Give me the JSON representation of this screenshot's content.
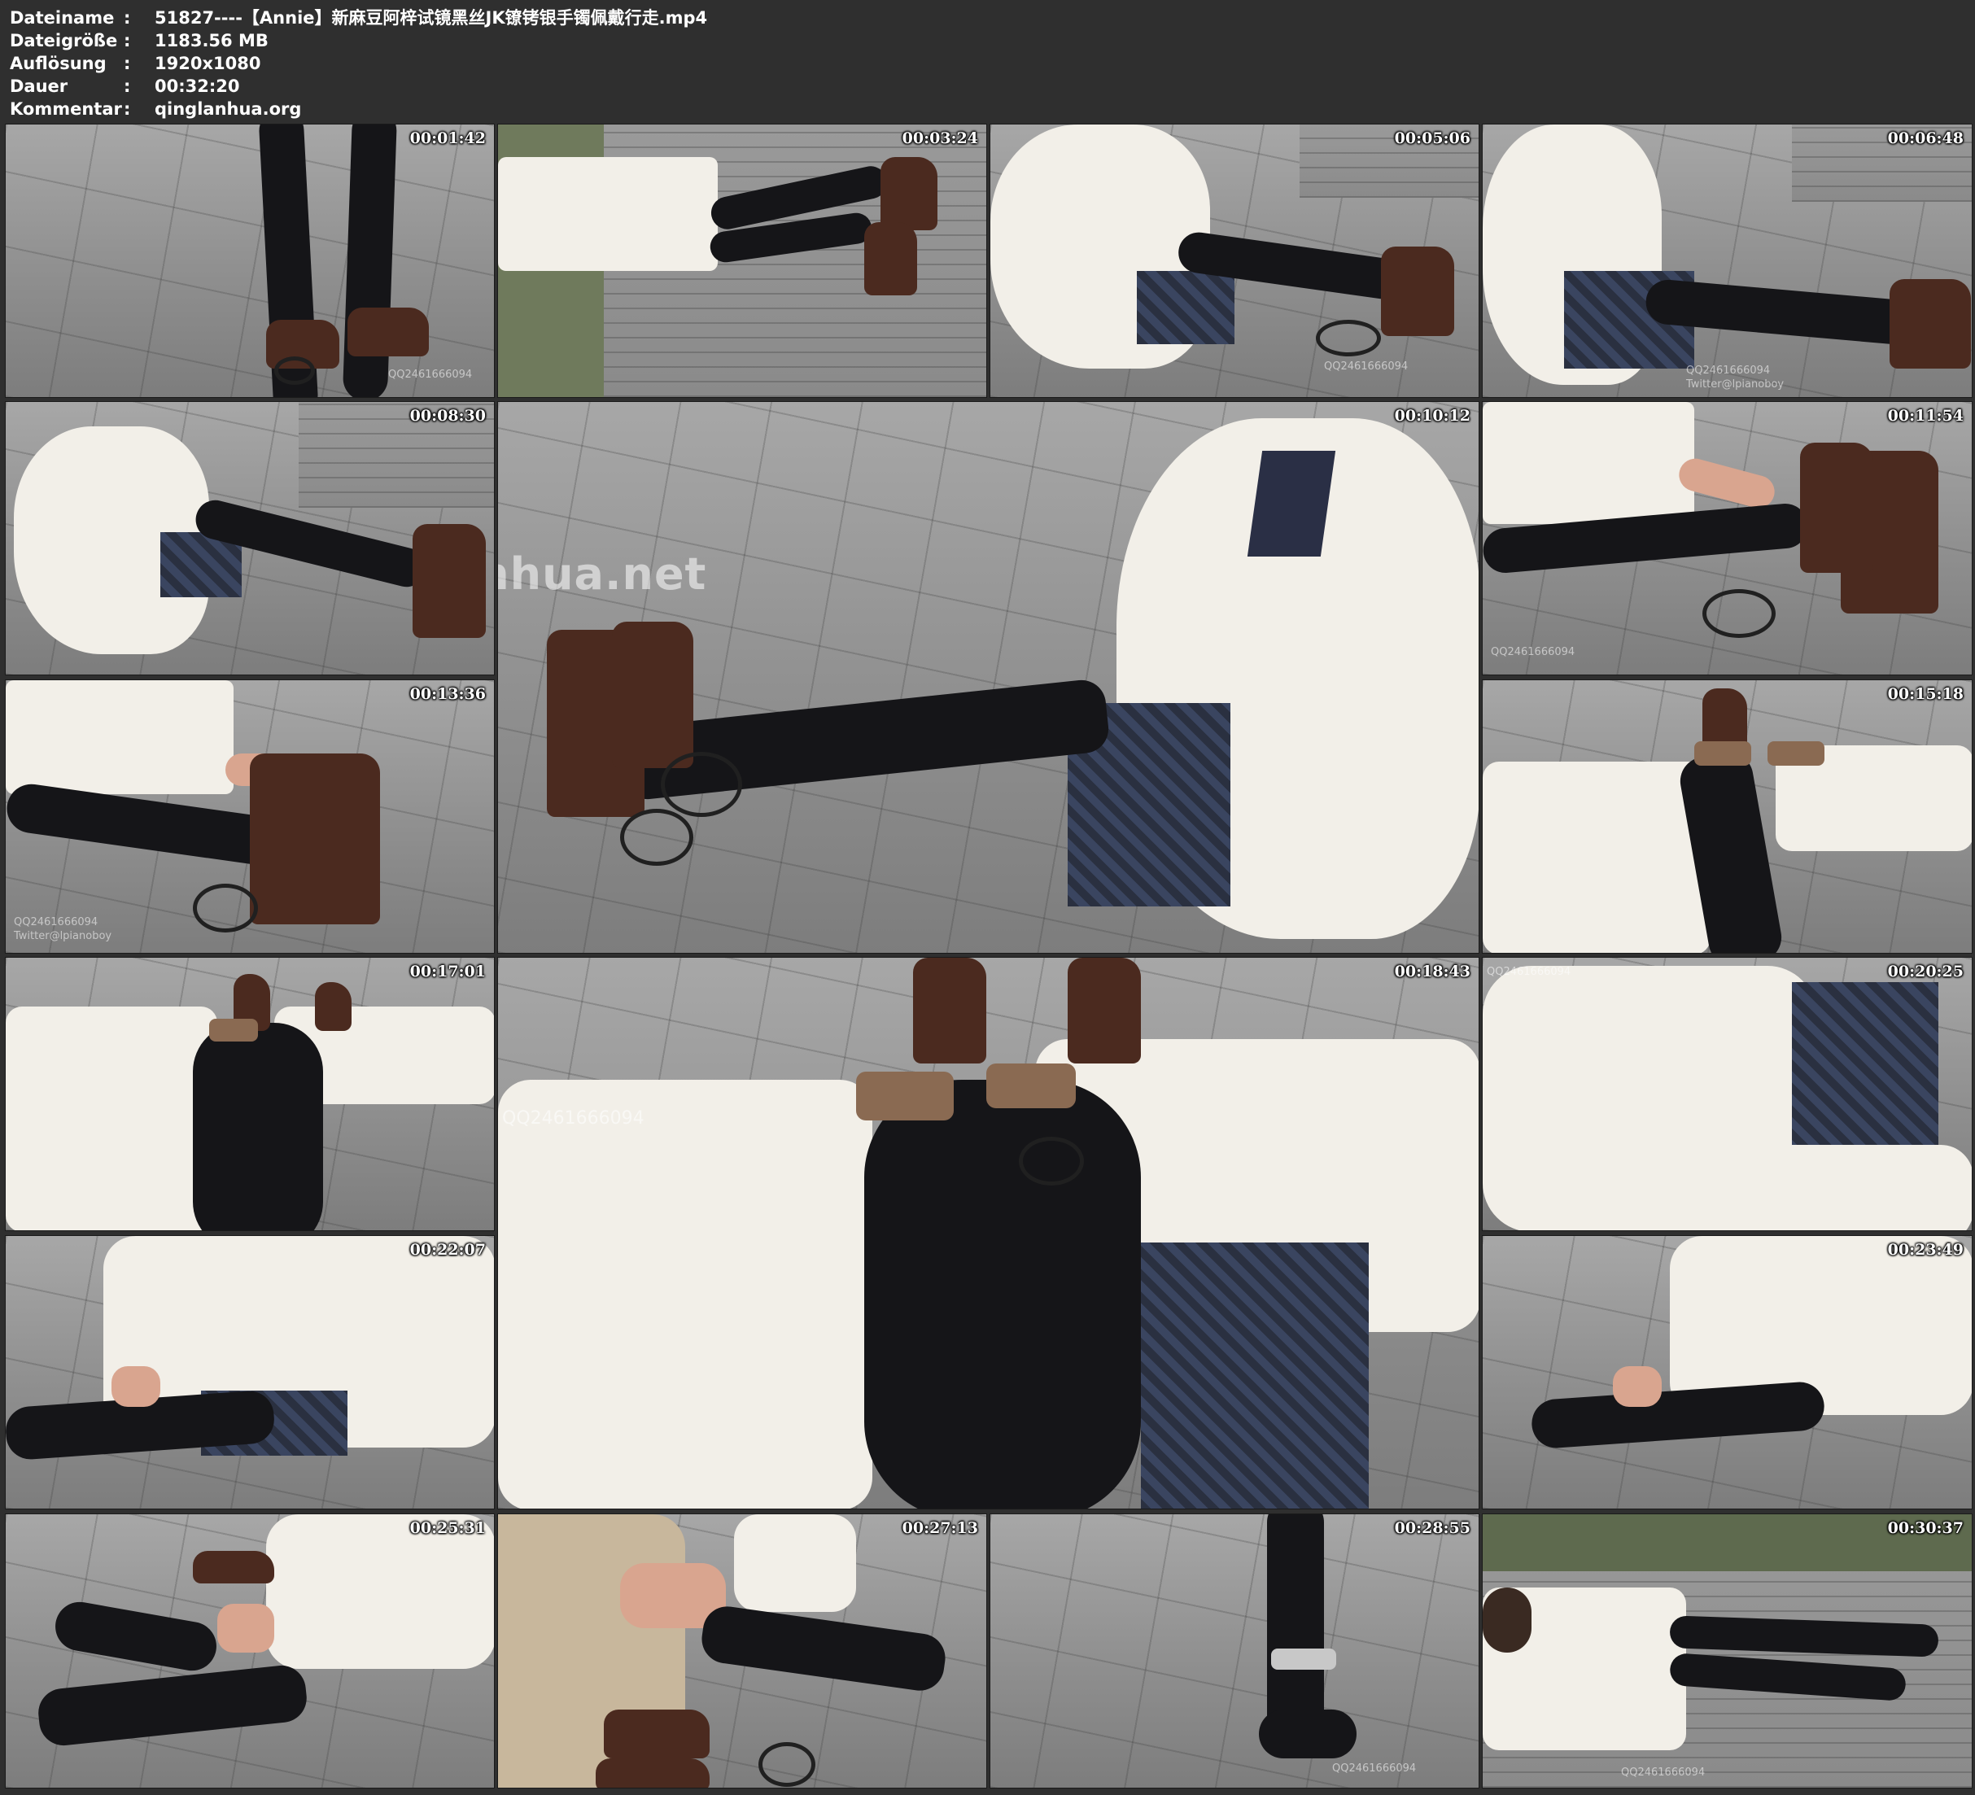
{
  "metadata": {
    "rows": [
      {
        "key": "Dateiname",
        "value": "51827----【Annie】新麻豆阿梓试镜黑丝JK镣铐银手镯佩戴行走.mp4"
      },
      {
        "key": "Dateigröße",
        "value": "1183.56 MB"
      },
      {
        "key": "Auflösung",
        "value": "1920x1080"
      },
      {
        "key": "Dauer",
        "value": "00:32:20"
      },
      {
        "key": "Kommentar",
        "value": "qinglanhua.org"
      }
    ],
    "separator": ":"
  },
  "thumbnails": [
    {
      "timestamp": "00:01:42",
      "scene": "legs-standing-pavement"
    },
    {
      "timestamp": "00:03:24",
      "scene": "legs-rotated-wall"
    },
    {
      "timestamp": "00:05:06",
      "scene": "sitting-white-sweater"
    },
    {
      "timestamp": "00:06:48",
      "scene": "sitting-white-sweater-plaid-skirt"
    },
    {
      "timestamp": "00:08:30",
      "scene": "sitting-side-wall"
    },
    {
      "timestamp": "00:10:12",
      "scene": "sitting-wide-closeup"
    },
    {
      "timestamp": "00:11:54",
      "scene": "hand-on-shoe"
    },
    {
      "timestamp": "00:13:36",
      "scene": "hands-ankle-cuffs"
    },
    {
      "timestamp": "00:15:18",
      "scene": "pov-legs-cuffs"
    },
    {
      "timestamp": "00:17:01",
      "scene": "pov-knees"
    },
    {
      "timestamp": "00:18:43",
      "scene": "pov-knees-wide"
    },
    {
      "timestamp": "00:20:25",
      "scene": "sweater-closeup"
    },
    {
      "timestamp": "00:22:07",
      "scene": "sitting-holding-feet"
    },
    {
      "timestamp": "00:23:49",
      "scene": "sitting-holding-feet-2"
    },
    {
      "timestamp": "00:25:31",
      "scene": "feet-closeup-shoes-off"
    },
    {
      "timestamp": "00:27:13",
      "scene": "man-unlocking-cuffs"
    },
    {
      "timestamp": "00:28:55",
      "scene": "standing-ankle-cuff"
    },
    {
      "timestamp": "00:30:37",
      "scene": "sitting-rotated-wall"
    }
  ],
  "watermarks": {
    "qq": "QQ2461666094",
    "twitter": "Twitter@lpianoboy",
    "site": "qinglanhua.net"
  },
  "colors": {
    "background": "#2f2f2f",
    "text": "#ffffff",
    "pavement": "#8f8f8f",
    "sweater": "#f2efe8",
    "tights": "#151518",
    "shoe": "#4b2a1f"
  }
}
